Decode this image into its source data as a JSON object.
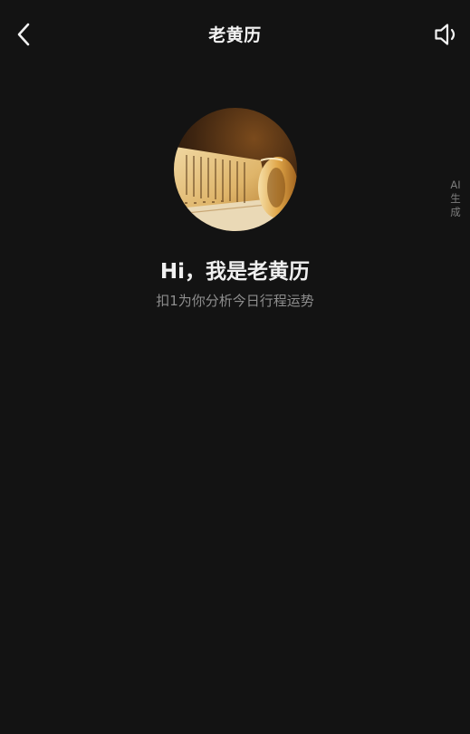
{
  "header": {
    "title": "老黄历",
    "back_icon": "chevron-left-icon",
    "sound_icon": "speaker-icon"
  },
  "avatar": {
    "description_icon": "ancient-scroll-avatar"
  },
  "ai_tag": "AI生成",
  "greeting": "Hi，我是老黄历",
  "subtitle": "扣1为你分析今日行程运势",
  "colors": {
    "background": "#131313",
    "text_primary": "#f0f0f0",
    "text_secondary": "#8e8e8e"
  }
}
